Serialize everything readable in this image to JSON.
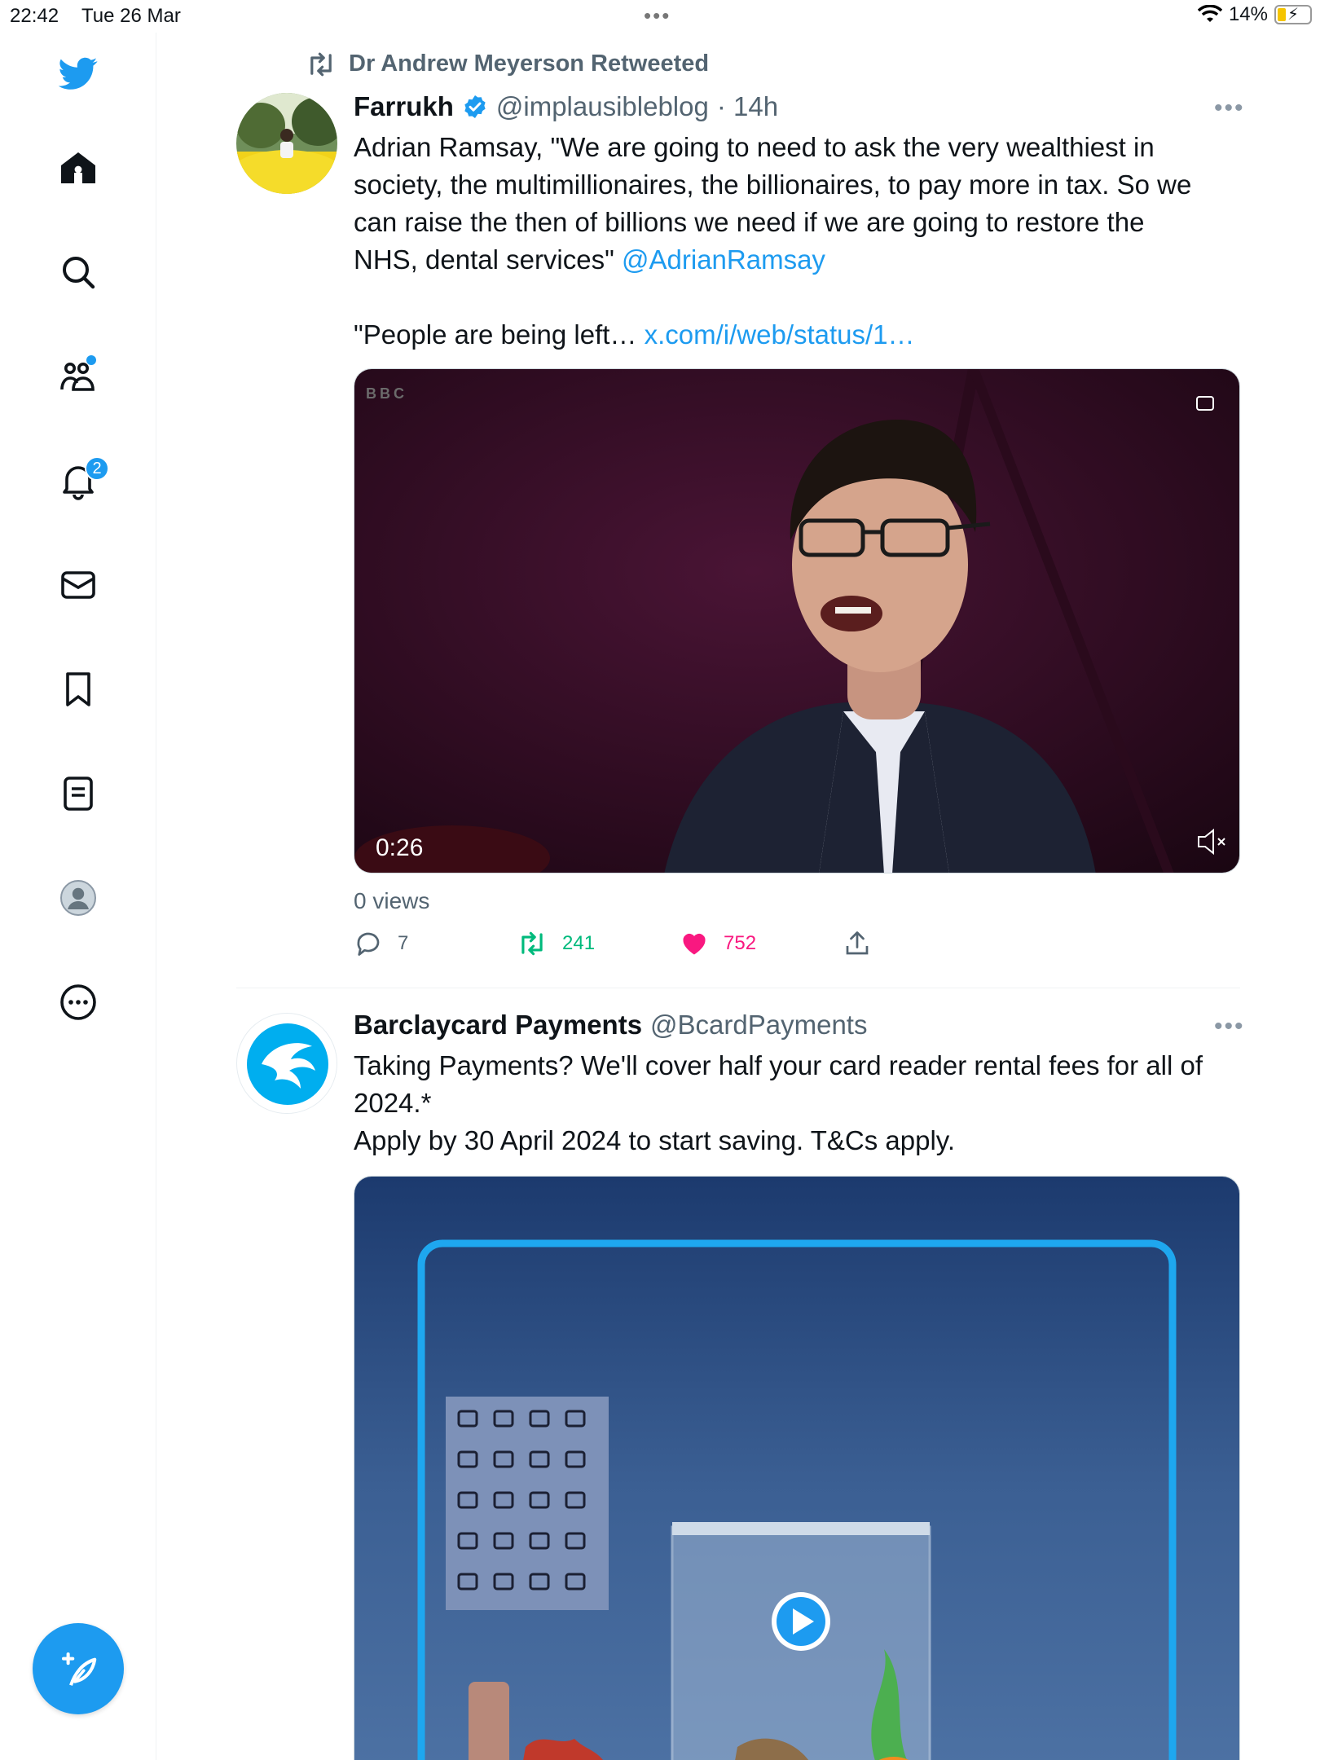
{
  "status_bar": {
    "time": "22:42",
    "date": "Tue 26 Mar",
    "battery": "14%"
  },
  "colors": {
    "accent": "#1d9bf0",
    "like": "#f91880",
    "retweet": "#00ba7c",
    "muted": "#536471"
  },
  "sidebar": {
    "items": [
      {
        "name": "twitter-logo-icon"
      },
      {
        "name": "home-icon"
      },
      {
        "name": "search-icon"
      },
      {
        "name": "communities-icon"
      },
      {
        "name": "notifications-icon",
        "badge": "2"
      },
      {
        "name": "messages-icon"
      },
      {
        "name": "bookmarks-icon"
      },
      {
        "name": "lists-icon"
      },
      {
        "name": "profile-icon"
      },
      {
        "name": "more-icon"
      }
    ]
  },
  "tweet1": {
    "retweeted_by": "Dr Andrew Meyerson Retweeted",
    "name": "Farrukh",
    "handle": "@implausibleblog",
    "time": "· 14h",
    "text_line1": "Adrian Ramsay, \"We are going to need to ask the very wealthiest in",
    "text_line2": "society, the multimillionaires, the billionaires, to pay more in tax. So we",
    "text_line3": "can raise the then of billions we need if we are going to restore the",
    "text_line4_prefix": "NHS, dental services\" ",
    "mention": "@AdrianRamsay",
    "text_line5_prefix": "\"People are being left… ",
    "link": "x.com/i/web/status/1…",
    "video_logo": "BBC",
    "video_duration": "0:26",
    "views": "0 views",
    "replies": "7",
    "retweets": "241",
    "likes": "752"
  },
  "tweet2": {
    "name": "Barclaycard Payments",
    "handle": "@BcardPayments",
    "text_line1": "Taking Payments? We'll cover half your card reader rental fees for all of",
    "text_line2": "2024.*",
    "text_line3": "Apply by 30 April 2024 to start saving. T&Cs apply."
  }
}
